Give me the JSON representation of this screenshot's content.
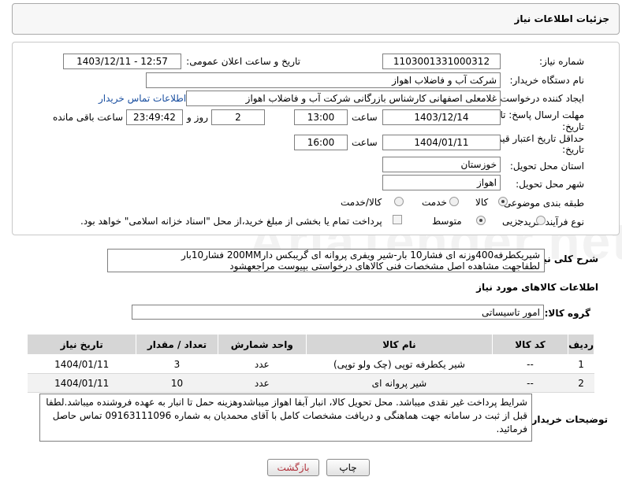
{
  "header": {
    "title": "جزئیات اطلاعات نیاز"
  },
  "form": {
    "need_number_label": "شماره نیاز:",
    "need_number": "1103001331000312",
    "announce_label": "تاریخ و ساعت اعلان عمومی:",
    "announce_value": "1403/12/11 - 12:57",
    "buyer_org_label": "نام دستگاه خریدار:",
    "buyer_org": "شرکت آب و فاضلاب اهواز",
    "creator_label": "ایجاد کننده درخواست:",
    "creator": "غلامعلی اصفهانی کارشناس بازرگانی شرکت آب و فاضلاب اهواز",
    "contact_link": "اطلاعات تماس خریدار",
    "reply_deadline_label_1": "مهلت ارسال پاسخ: تا",
    "reply_deadline_label_2": "تاریخ:",
    "reply_date": "1403/12/14",
    "time_label": "ساعت",
    "reply_time": "13:00",
    "days_value": "2",
    "days_label": "روز و",
    "remaining_time": "23:49:42",
    "remaining_label": "ساعت باقی مانده",
    "price_validity_label_1": "حداقل تاریخ اعتبار قیمت: تا",
    "price_validity_label_2": "تاریخ:",
    "price_date": "1404/01/11",
    "price_time": "16:00",
    "province_label": "استان محل تحویل:",
    "province": "خوزستان",
    "city_label": "شهر محل تحویل:",
    "city": "اهواز",
    "category_label": "طبقه بندی موضوعی:",
    "category_options": [
      "کالا",
      "خدمت",
      "کالا/خدمت"
    ],
    "category_selected": "کالا",
    "purchase_type_label": "نوع فرآیند خرید :",
    "purchase_options": [
      "جزیی",
      "متوسط"
    ],
    "purchase_selected": "متوسط",
    "treasury_text": "پرداخت تمام یا بخشی از مبلغ خرید،از محل \"اسناد خزانه اسلامی\" خواهد بود."
  },
  "description": {
    "label": "شرح کلی نیاز:",
    "line1": "شیریکطرفه400وزنه ای فشار10 بار-شیر ویفری پروانه ای گریبکس دار200MM فشار10بار",
    "line2": "لطفاجهت مشاهده اصل مشخصات فنی کالاهای درخواستی بپیوست مراجعهشود"
  },
  "goods_section": {
    "title": "اطلاعات کالاهای مورد نیاز",
    "group_label": "گروه کالا:",
    "group_value": "امور تاسیساتی"
  },
  "table": {
    "headers": [
      "ردیف",
      "کد کالا",
      "نام کالا",
      "واحد شمارش",
      "تعداد / مقدار",
      "تاریخ نیاز"
    ],
    "rows": [
      [
        "1",
        "--",
        "شیر یکطرفه توپی (چک ولو توپی)",
        "عدد",
        "3",
        "1404/01/11"
      ],
      [
        "2",
        "--",
        "شیر پروانه ای",
        "عدد",
        "10",
        "1404/01/11"
      ]
    ]
  },
  "buyer_notes": {
    "label": "توضیحات خریدار:",
    "text": "شرایط پرداخت غیر نقدی میباشد. محل تحویل کالا، انبار آبفا اهواز میباشدوهزینه حمل تا انبار به عهده فروشنده میباشد.لطفا قبل از ثبت در سامانه جهت هماهنگی و دریافت مشخصات کامل با آقای  محمدیان به شماره 09163111096 تماس حاصل فرمائید."
  },
  "buttons": {
    "print": "چاپ",
    "back": "بازگشت"
  },
  "watermark": "AriaTender.net",
  "colors": {
    "link": "#1a4fa0",
    "table_header": "#d6d6d6",
    "back_button_text": "#b0303a"
  }
}
